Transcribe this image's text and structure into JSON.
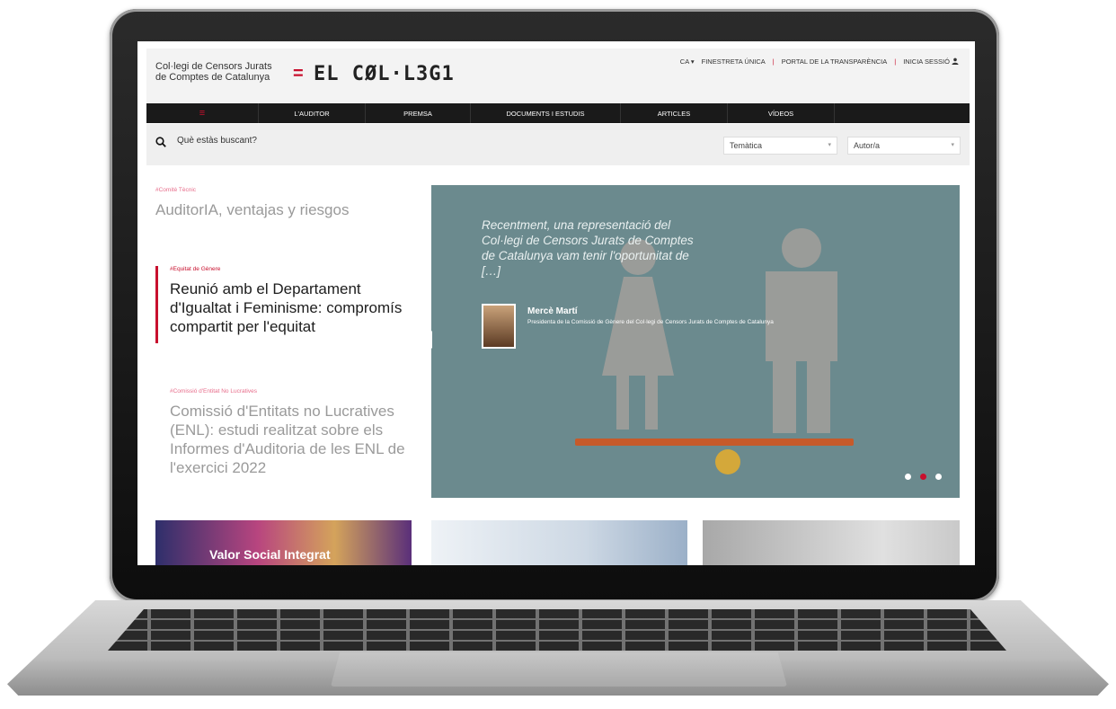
{
  "header": {
    "org_line1": "Col·legi de Censors Jurats",
    "org_line2": "de Comptes de Catalunya",
    "logo_symbol": "=",
    "logo_mark": "EL CØL·L3G1",
    "lang": "CA ▾",
    "links": [
      "FINESTRETA ÚNICA",
      "PORTAL DE LA TRANSPARÈNCIA",
      "INICIA SESSIÓ"
    ],
    "user_icon": "user-icon"
  },
  "nav": {
    "menu_icon": "≡",
    "items": [
      "L'AUDITOR",
      "PREMSA",
      "DOCUMENTS I ESTUDIS",
      "ARTICLES",
      "VÍDEOS"
    ]
  },
  "search": {
    "placeholder": "Què estàs buscant?",
    "filter1": "Temàtica",
    "filter2": "Autor/a"
  },
  "articles": [
    {
      "tag": "#Comitè Tècnic",
      "title": "AuditorIA, ventajas y riesgos"
    },
    {
      "tag": "#Equitat de Gènere",
      "title": "Reunió amb el Departament d'Igualtat i Feminisme: compromís compartit per l'equitat"
    },
    {
      "tag": "#Comissió d'Entitat No Lucratives",
      "title": "Comissió d'Entitats no Lucratives (ENL): estudi realitzat sobre els Informes d'Auditoria de les ENL de l'exercici 2022"
    }
  ],
  "hero": {
    "quote": "Recentment, una representació del Col·legi de Censors Jurats de Comptes de Catalunya vam tenir l'oportunitat de […]",
    "author_name": "Mercè Martí",
    "author_title": "Presidenta de la Comissió de Gènere del Col·legi de Censors Jurats de Comptes de Catalunya",
    "slides": 3,
    "active_slide": 2
  },
  "cards": [
    {
      "label": "Valor Social Integrat"
    }
  ],
  "colors": {
    "accent": "#c8102e",
    "nav_bg": "#1a1a1a",
    "hero_bg": "#6b8a8e"
  }
}
